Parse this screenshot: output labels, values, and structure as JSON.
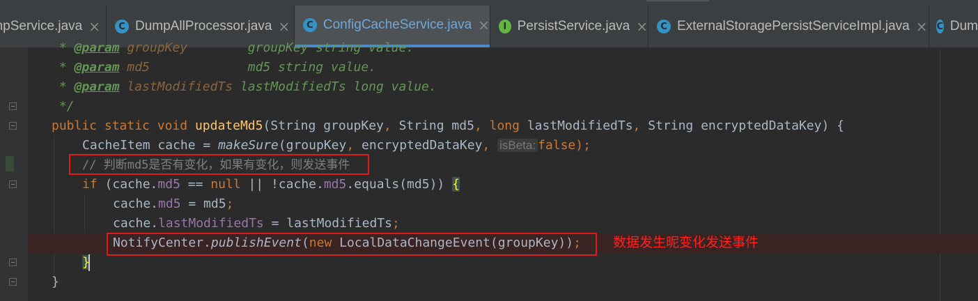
{
  "tabs": [
    {
      "label": "mpService.java",
      "icon": "C",
      "active": false
    },
    {
      "label": "DumpAllProcessor.java",
      "icon": "C",
      "active": false
    },
    {
      "label": "ConfigCacheService.java",
      "icon": "C",
      "active": true
    },
    {
      "label": "PersistService.java",
      "icon": "I",
      "active": false
    },
    {
      "label": "ExternalStoragePersistServiceImpl.java",
      "icon": "C",
      "active": false
    },
    {
      "label": "Dum",
      "icon": "C",
      "active": false
    }
  ],
  "tab_close_glyph": "×",
  "colors": {
    "class_icon": "#3592c4",
    "interface_icon": "#62b543",
    "annotation_red": "#e01a1a",
    "active_tab_underline": "#4a88c7"
  },
  "code": {
    "l1": {
      "star": " * ",
      "tag": "@param",
      "name": " groupKey       ",
      "desc": " groupKey string value."
    },
    "l2": {
      "star": " * ",
      "tag": "@param",
      "name": " md5            ",
      "desc": " md5 string value."
    },
    "l3": {
      "star": " * ",
      "tag": "@param",
      "name": " lastModifiedTs",
      "desc": " lastModifiedTs long value."
    },
    "l4": " */",
    "l5": {
      "kw1": "public",
      "kw2": "static",
      "kw3": "void",
      "fn": "updateMd5",
      "p1": "(String groupKey",
      "c1": ",",
      "p2": " String md5",
      "c2": ",",
      "kw4": " long",
      "p3": " lastModifiedTs",
      "c3": ",",
      "p4": " String encryptedDataKey) {"
    },
    "l6": {
      "pre": "CacheItem cache = ",
      "call": "makeSure",
      "args": "(groupKey",
      "c1": ",",
      "args2": " encryptedDataKey",
      "c2": ",",
      "hint": "isBeta:",
      "val": "false",
      "end": ");"
    },
    "l7": "// 判断md5是否有变化，如果有变化，则发送事件",
    "l8": {
      "kw": "if",
      "a": " (cache.",
      "f1": "md5",
      "b": " == ",
      "kw2": "null",
      "c": " || !cache.",
      "f2": "md5",
      "d": ".equals(md5)) ",
      "brace": "{"
    },
    "l9": {
      "a": "cache.",
      "f": "md5",
      "b": " = md5",
      "semi": ";"
    },
    "l10": {
      "a": "cache.",
      "f": "lastModifiedTs",
      "b": " = lastModifiedTs",
      "semi": ";"
    },
    "l11": {
      "a": "NotifyCenter.",
      "call": "publishEvent",
      "b": "(",
      "kw": "new",
      "c": " LocalDataChangeEvent(groupKey))",
      "semi": ";"
    },
    "l12": "}",
    "l13": "}"
  },
  "annotation": "数据发生昵变化发送事件"
}
